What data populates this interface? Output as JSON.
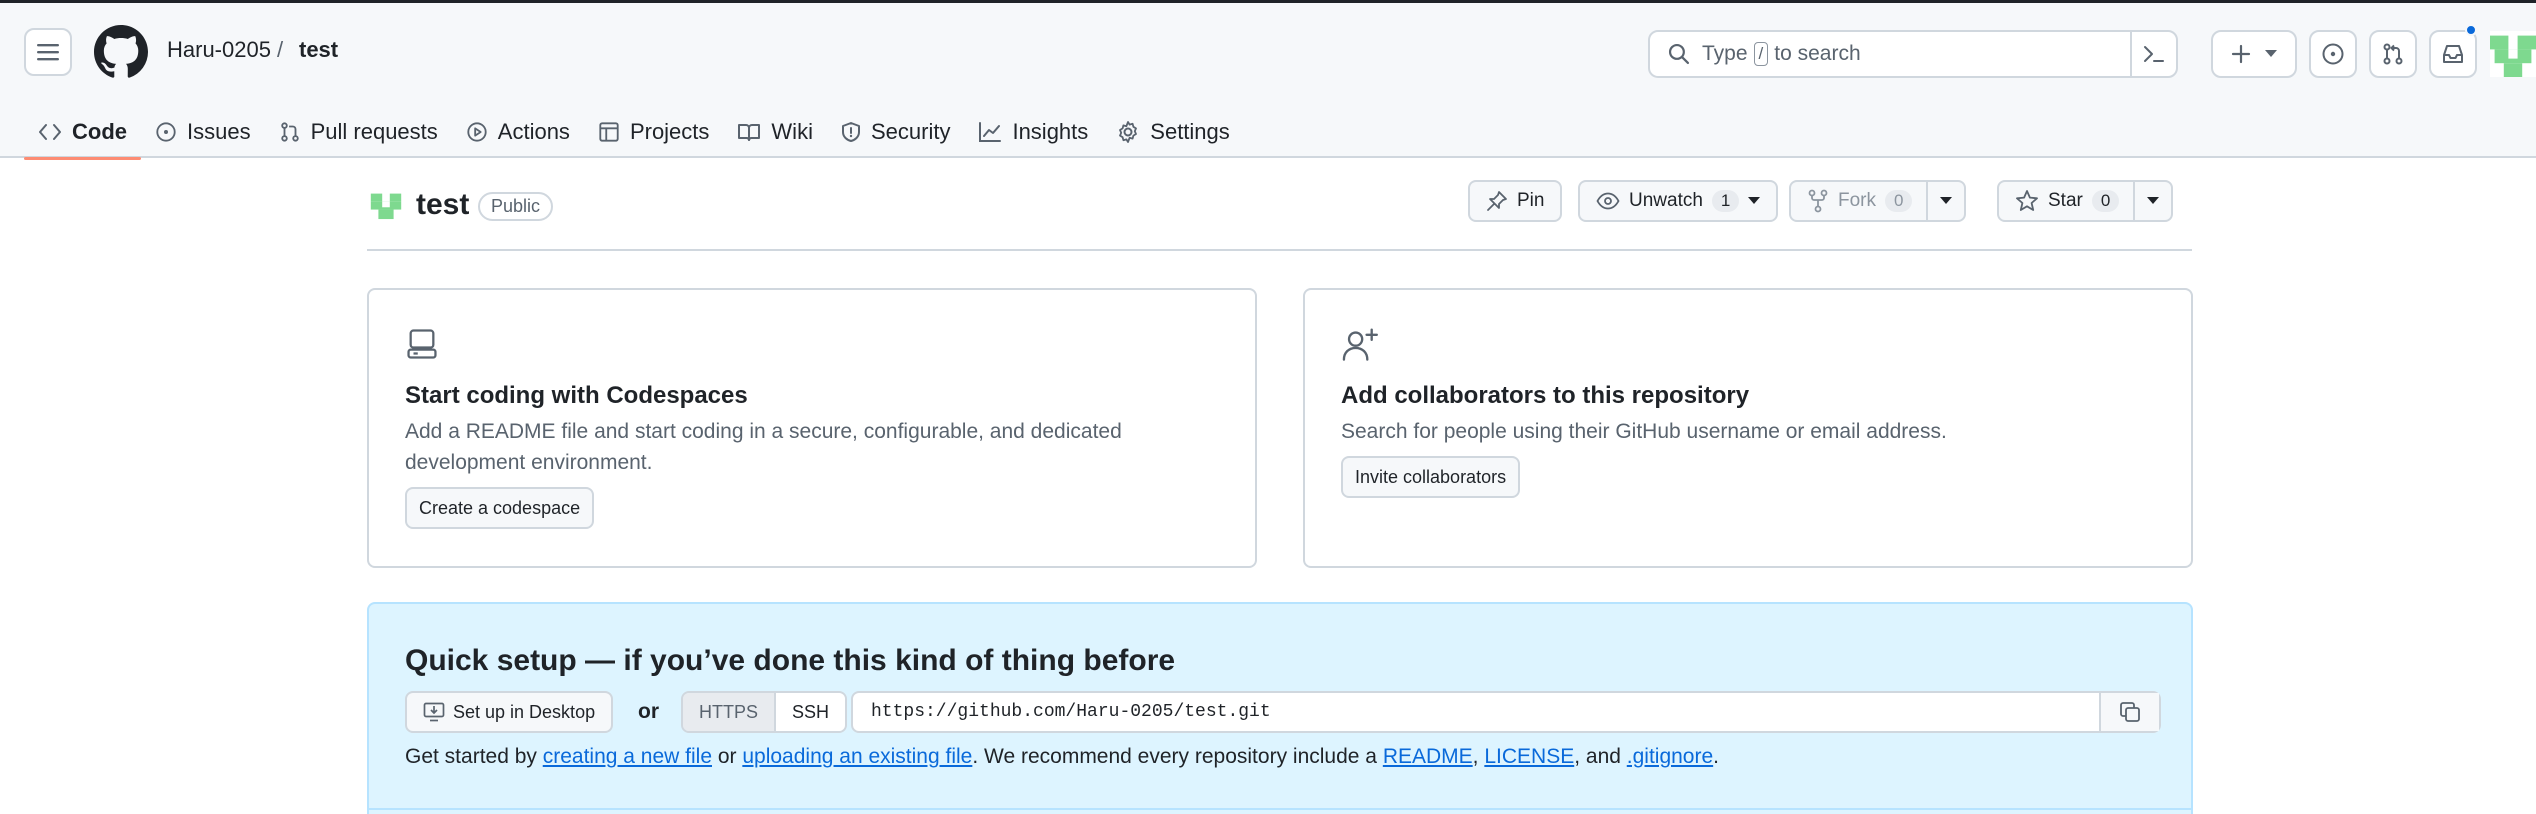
{
  "header": {
    "owner": "Haru-0205",
    "separator": "/",
    "repo": "test",
    "search": {
      "prefix": "Type",
      "key": "/",
      "suffix": "to search"
    },
    "icons": [
      "hamburger-icon",
      "github-logo-icon",
      "command-palette-icon",
      "plus-icon",
      "issue-icon",
      "pull-request-icon",
      "inbox-icon"
    ]
  },
  "nav": {
    "tabs": [
      {
        "label": "Code",
        "icon": "code-icon",
        "active": true
      },
      {
        "label": "Issues",
        "icon": "issue-icon"
      },
      {
        "label": "Pull requests",
        "icon": "pull-request-icon"
      },
      {
        "label": "Actions",
        "icon": "play-icon"
      },
      {
        "label": "Projects",
        "icon": "table-icon"
      },
      {
        "label": "Wiki",
        "icon": "book-icon"
      },
      {
        "label": "Security",
        "icon": "shield-icon"
      },
      {
        "label": "Insights",
        "icon": "graph-icon"
      },
      {
        "label": "Settings",
        "icon": "gear-icon"
      }
    ]
  },
  "repo": {
    "name": "test",
    "visibility": "Public",
    "pin_label": "Pin",
    "watch_label": "Unwatch",
    "watch_count": "1",
    "fork_label": "Fork",
    "fork_count": "0",
    "star_label": "Star",
    "star_count": "0"
  },
  "cards": {
    "codespaces": {
      "title": "Start coding with Codespaces",
      "desc_line1": "Add a README file and start coding in a secure, configurable, and dedicated",
      "desc_line2": "development environment.",
      "button": "Create a codespace"
    },
    "collaborators": {
      "title": "Add collaborators to this repository",
      "desc": "Search for people using their GitHub username or email address.",
      "button": "Invite collaborators"
    }
  },
  "quick_setup": {
    "title": "Quick setup — if you’ve done this kind of thing before",
    "desktop_button": "Set up in Desktop",
    "or": "or",
    "https": "HTTPS",
    "ssh": "SSH",
    "url": "https://github.com/Haru-0205/test.git",
    "text_start": "Get started by ",
    "link_new_file": "creating a new file",
    "text_or": " or ",
    "link_upload": "uploading an existing file",
    "text_recommend": ". We recommend every repository include a ",
    "link_readme": "README",
    "text_comma1": ", ",
    "link_license": "LICENSE",
    "text_and": ", and ",
    "link_gitignore": ".gitignore",
    "text_end": "."
  },
  "colors": {
    "accent": "#0969da",
    "tab_underline": "#fd8c73",
    "quick_bg": "#ddf4ff",
    "avatar_green": "#7ed98f"
  }
}
